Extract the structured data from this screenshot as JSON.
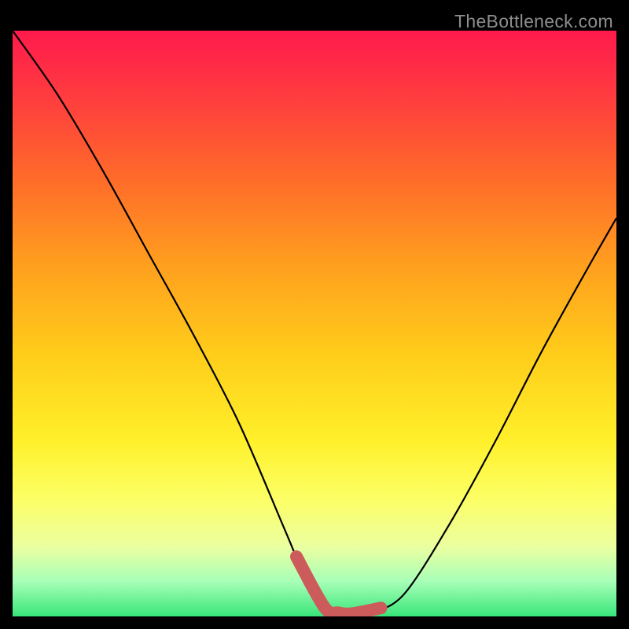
{
  "watermark": "TheBottleneck.com",
  "chart_data": {
    "type": "line",
    "title": "",
    "xlabel": "",
    "ylabel": "",
    "xlim": [
      0,
      100
    ],
    "ylim": [
      0,
      100
    ],
    "series": [
      {
        "name": "bottleneck-curve",
        "x": [
          0,
          7.5,
          15,
          22.5,
          30,
          37.5,
          45,
          50,
          52.5,
          55,
          57.5,
          60,
          65,
          72.5,
          80,
          87.5,
          95,
          100
        ],
        "y": [
          100,
          89,
          76,
          62,
          48,
          33,
          15,
          3,
          0.8,
          0.5,
          0.5,
          0.8,
          4,
          16,
          30,
          45,
          59,
          68
        ]
      }
    ],
    "accent_range_x": [
      47,
      61
    ],
    "note": "Axis-less bottleneck curve on gradient background; x and y are normalized 0–100 where 0 is left/bottom. Values are estimated from the image."
  }
}
